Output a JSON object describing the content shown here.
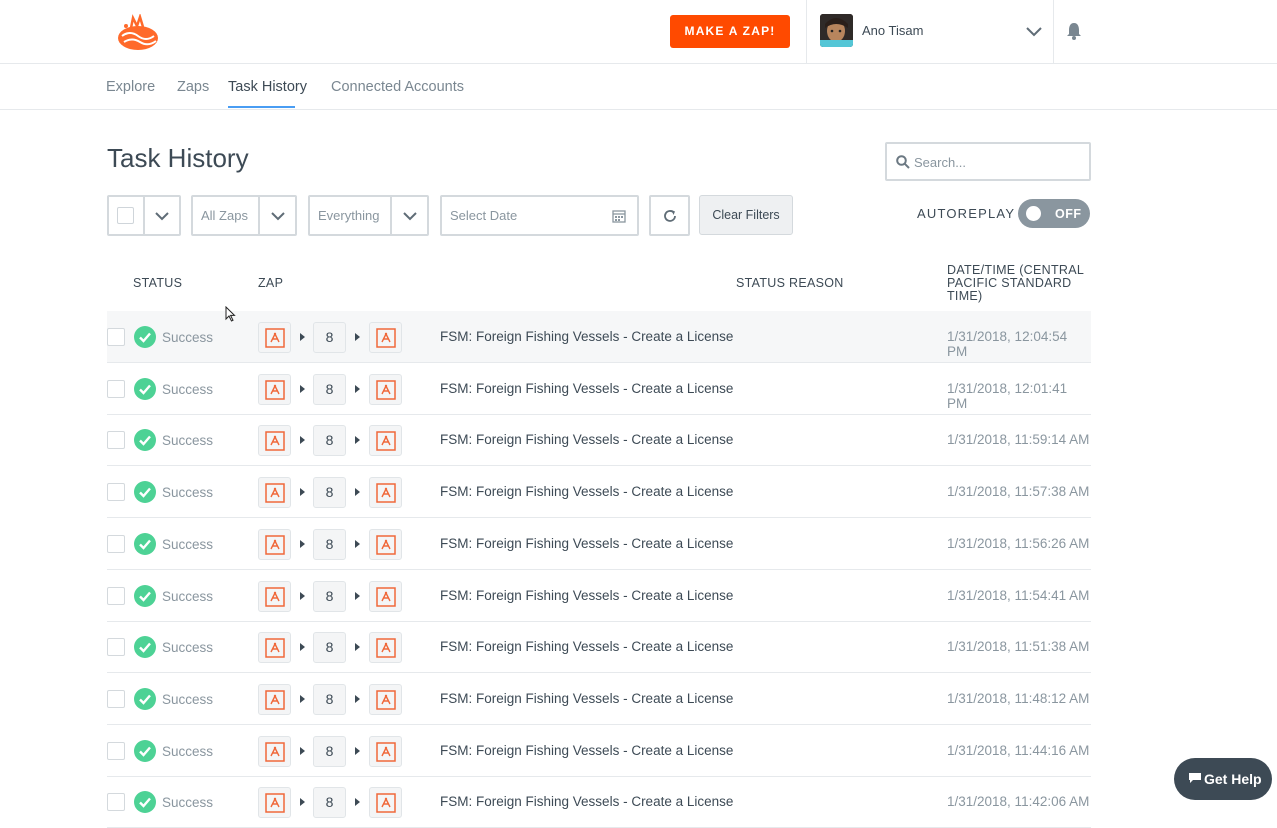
{
  "header": {
    "make_zap_label": "MAKE A ZAP!",
    "user_name": "Ano Tisam",
    "brand_color": "#ff4a00"
  },
  "tabs": [
    {
      "label": "Explore",
      "active": false
    },
    {
      "label": "Zaps",
      "active": false
    },
    {
      "label": "Task History",
      "active": true
    },
    {
      "label": "Connected Accounts",
      "active": false
    }
  ],
  "page": {
    "title": "Task History",
    "search_placeholder": "Search..."
  },
  "filters": {
    "zaps_select": "All Zaps",
    "type_select": "Everything",
    "date_placeholder": "Select Date",
    "clear_label": "Clear Filters",
    "autoreplay_label": "AUTOREPLAY",
    "autoreplay_state": "OFF"
  },
  "table": {
    "headers": {
      "status": "STATUS",
      "zap": "ZAP",
      "status_reason": "STATUS REASON",
      "datetime": "DATE/TIME (CENTRAL PACIFIC STANDARD TIME)"
    },
    "rows": [
      {
        "status": "Success",
        "steps": "8",
        "zap": "FSM: Foreign Fishing Vessels - Create a License",
        "date": "1/31/2018, 12:04:54 PM"
      },
      {
        "status": "Success",
        "steps": "8",
        "zap": "FSM: Foreign Fishing Vessels - Create a License",
        "date": "1/31/2018, 12:01:41 PM"
      },
      {
        "status": "Success",
        "steps": "8",
        "zap": "FSM: Foreign Fishing Vessels - Create a License",
        "date": "1/31/2018, 11:59:14 AM"
      },
      {
        "status": "Success",
        "steps": "8",
        "zap": "FSM: Foreign Fishing Vessels - Create a License",
        "date": "1/31/2018, 11:57:38 AM"
      },
      {
        "status": "Success",
        "steps": "8",
        "zap": "FSM: Foreign Fishing Vessels - Create a License",
        "date": "1/31/2018, 11:56:26 AM"
      },
      {
        "status": "Success",
        "steps": "8",
        "zap": "FSM: Foreign Fishing Vessels - Create a License",
        "date": "1/31/2018, 11:54:41 AM"
      },
      {
        "status": "Success",
        "steps": "8",
        "zap": "FSM: Foreign Fishing Vessels - Create a License",
        "date": "1/31/2018, 11:51:38 AM"
      },
      {
        "status": "Success",
        "steps": "8",
        "zap": "FSM: Foreign Fishing Vessels - Create a License",
        "date": "1/31/2018, 11:48:12 AM"
      },
      {
        "status": "Success",
        "steps": "8",
        "zap": "FSM: Foreign Fishing Vessels - Create a License",
        "date": "1/31/2018, 11:44:16 AM"
      },
      {
        "status": "Success",
        "steps": "8",
        "zap": "FSM: Foreign Fishing Vessels - Create a License",
        "date": "1/31/2018, 11:42:06 AM"
      }
    ]
  },
  "help": {
    "label": "Get Help"
  },
  "colors": {
    "success": "#4dd295",
    "accent_tab": "#499df3",
    "app_icon": "#f0683a"
  }
}
